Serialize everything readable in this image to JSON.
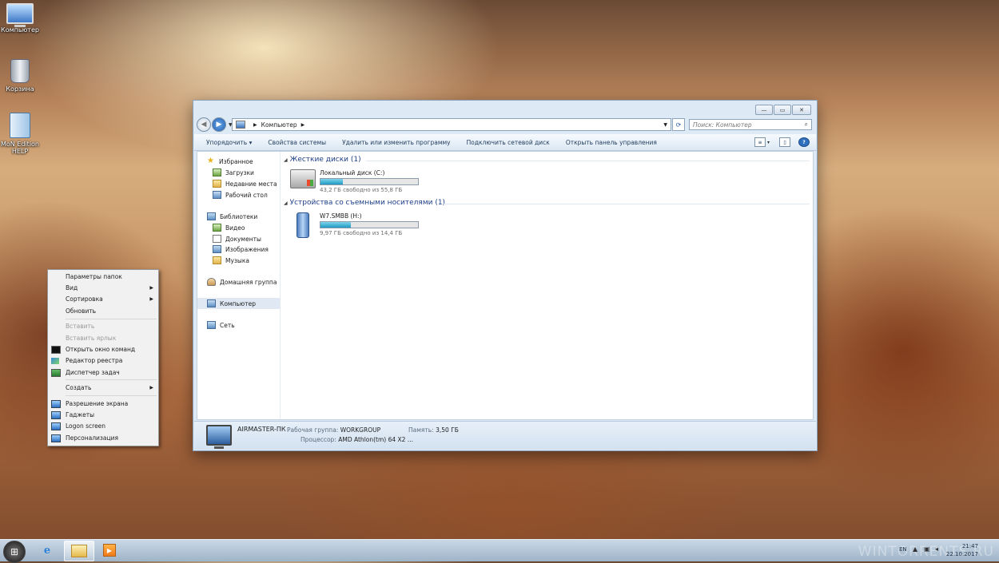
{
  "desktop": {
    "icons": [
      {
        "label": "Компьютер"
      },
      {
        "label": "Корзина"
      },
      {
        "label": "MoN Edition HELP"
      }
    ]
  },
  "explorer": {
    "address": {
      "path": "Компьютер"
    },
    "search": {
      "placeholder": "Поиск: Компьютер"
    },
    "toolbar": {
      "organize": "Упорядочить",
      "system_properties": "Свойства системы",
      "uninstall": "Удалить или изменить программу",
      "map_drive": "Подключить сетевой диск",
      "control_panel": "Открыть панель управления"
    },
    "nav": {
      "favorites": "Избранное",
      "downloads": "Загрузки",
      "recent": "Недавние места",
      "desktop": "Рабочий стол",
      "libraries": "Библиотеки",
      "video": "Видео",
      "documents": "Документы",
      "pictures": "Изображения",
      "music": "Музыка",
      "homegroup": "Домашняя группа",
      "computer": "Компьютер",
      "network": "Сеть"
    },
    "groups": {
      "hard_drives": "Жесткие диски (1)",
      "removable": "Устройства со съемными носителями (1)"
    },
    "drives": [
      {
        "name": "Локальный диск (C:)",
        "free": "43,2 ГБ свободно из 55,8 ГБ",
        "used_fraction": 0.23
      },
      {
        "name": "W7.SMBB (H:)",
        "free": "9,97 ГБ свободно из 14,4 ГБ",
        "used_fraction": 0.31
      }
    ],
    "details": {
      "computer_name": "AIRMASTER-ПК",
      "workgroup_label": "Рабочая группа:",
      "workgroup_value": "WORKGROUP",
      "memory_label": "Память:",
      "memory_value": "3,50 ГБ",
      "cpu_label": "Процессор:",
      "cpu_value": "AMD Athlon(tm) 64 X2 ..."
    }
  },
  "context_menu": {
    "items": [
      {
        "label": "Параметры папок"
      },
      {
        "label": "Вид"
      },
      {
        "label": "Сортировка"
      },
      {
        "label": "Обновить"
      },
      {
        "label": "Вставить"
      },
      {
        "label": "Вставить ярлык"
      },
      {
        "label": "Открыть окно команд"
      },
      {
        "label": "Редактор реестра"
      },
      {
        "label": "Диспетчер задач"
      },
      {
        "label": "Создать"
      },
      {
        "label": "Разрешение экрана"
      },
      {
        "label": "Гаджеты"
      },
      {
        "label": "Logon screen"
      },
      {
        "label": "Персонализация"
      }
    ]
  },
  "taskbar": {
    "lang": "EN",
    "time": "21:47",
    "date": "22.10.2017",
    "watermark": "WINTORRENTS.RU"
  },
  "icons": {
    "start": "windows-orb-icon",
    "ie": "internet-explorer-icon",
    "explorer": "folder-icon",
    "media": "media-player-icon"
  }
}
